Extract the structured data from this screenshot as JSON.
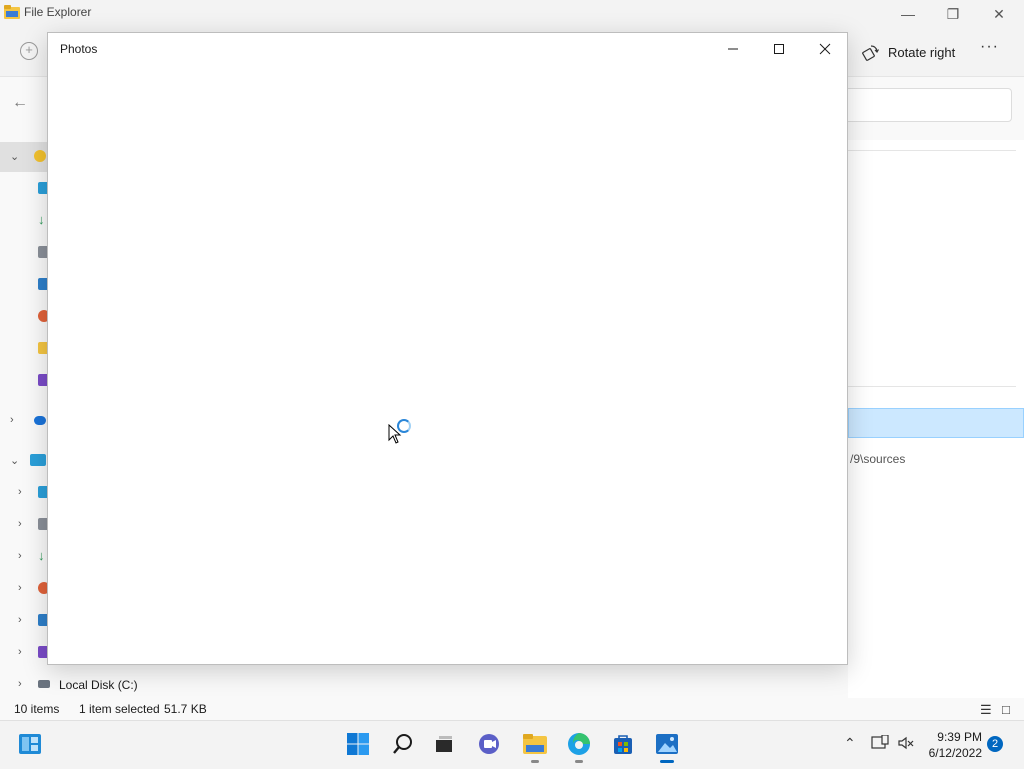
{
  "explorer": {
    "title": "File Explorer",
    "command_bar": {
      "rotate_right_label": "Rotate right",
      "more_label": "···"
    },
    "nav_items": [
      {
        "label": ""
      },
      {
        "label": ""
      },
      {
        "label": ""
      },
      {
        "label": ""
      },
      {
        "label": ""
      },
      {
        "label": ""
      },
      {
        "label": ""
      },
      {
        "label": ""
      },
      {
        "label": ""
      },
      {
        "label": ""
      },
      {
        "label": ""
      },
      {
        "label": ""
      },
      {
        "label": ""
      },
      {
        "label": ""
      },
      {
        "label": ""
      },
      {
        "label": "Local Disk (C:)"
      }
    ],
    "selected_path_fragment": "/9\\sources",
    "status": {
      "item_count": "10 items",
      "selection": "1 item selected",
      "size": "51.7 KB"
    }
  },
  "photos": {
    "title": "Photos",
    "state": "loading"
  },
  "taskbar": {
    "apps": [
      "widgets",
      "start",
      "search",
      "task-view",
      "chat",
      "file-explorer",
      "edge",
      "store",
      "photos"
    ],
    "clock_time": "9:39 PM",
    "clock_date": "6/12/2022",
    "notification_count": "2"
  },
  "colors": {
    "accent": "#0067c0",
    "selection": "#cce8ff",
    "spinner": "#2a86d8"
  }
}
